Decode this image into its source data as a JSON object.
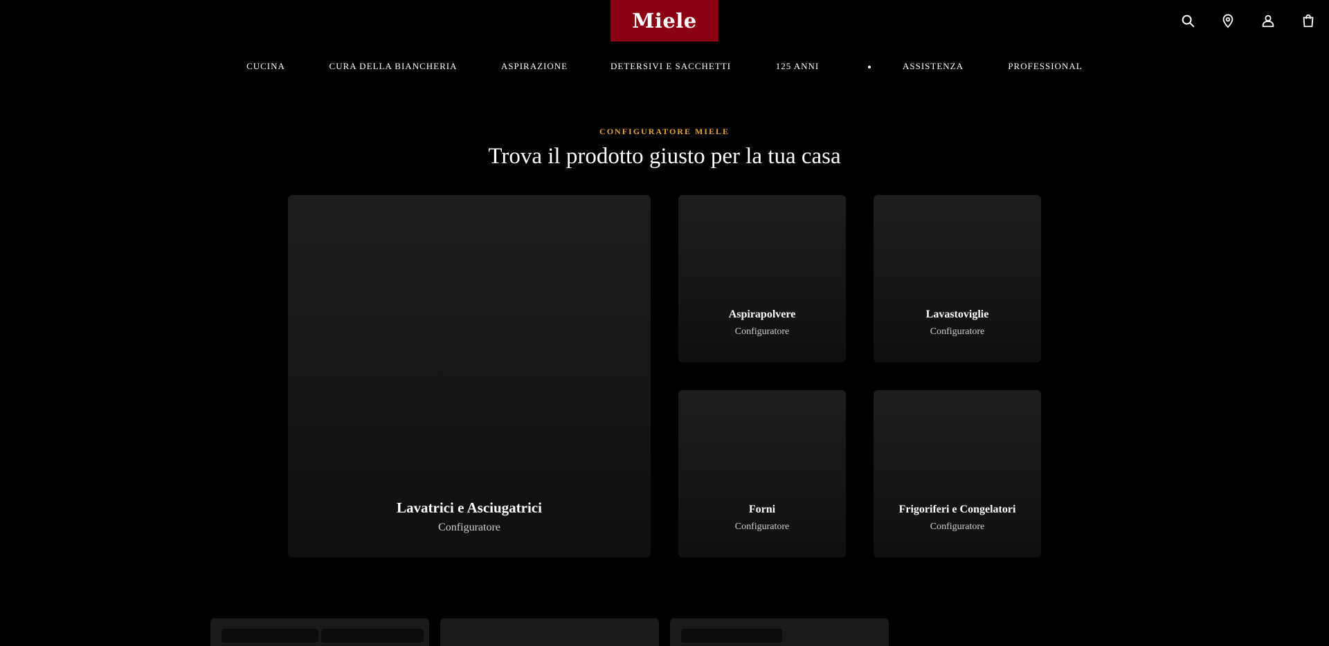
{
  "brand": {
    "logo_text": "Miele",
    "logo_color": "#8c0014"
  },
  "utility": {
    "icons": [
      "search-icon",
      "store-locator-icon",
      "account-icon",
      "cart-icon"
    ]
  },
  "nav": {
    "items": [
      "CUCINA",
      "CURA DELLA BIANCHERIA",
      "ASPIRAZIONE",
      "DETERSIVI E SACCHETTI",
      "125 ANNI",
      "ASSISTENZA",
      "PROFESSIONAL"
    ]
  },
  "configurator": {
    "eyebrow": "CONFIGURATORE MIELE",
    "eyebrow_color": "#e6a534",
    "title": "Trova il prodotto giusto per la tua casa",
    "cards": [
      {
        "title": "Lavatrici e Asciugatrici",
        "subtitle": "Configuratore"
      },
      {
        "title": "Aspirapolvere",
        "subtitle": "Configuratore"
      },
      {
        "title": "Lavastoviglie",
        "subtitle": "Configuratore"
      },
      {
        "title": "Forni",
        "subtitle": "Configuratore"
      },
      {
        "title": "Frigoriferi e Congelatori",
        "subtitle": "Configuratore"
      }
    ]
  }
}
